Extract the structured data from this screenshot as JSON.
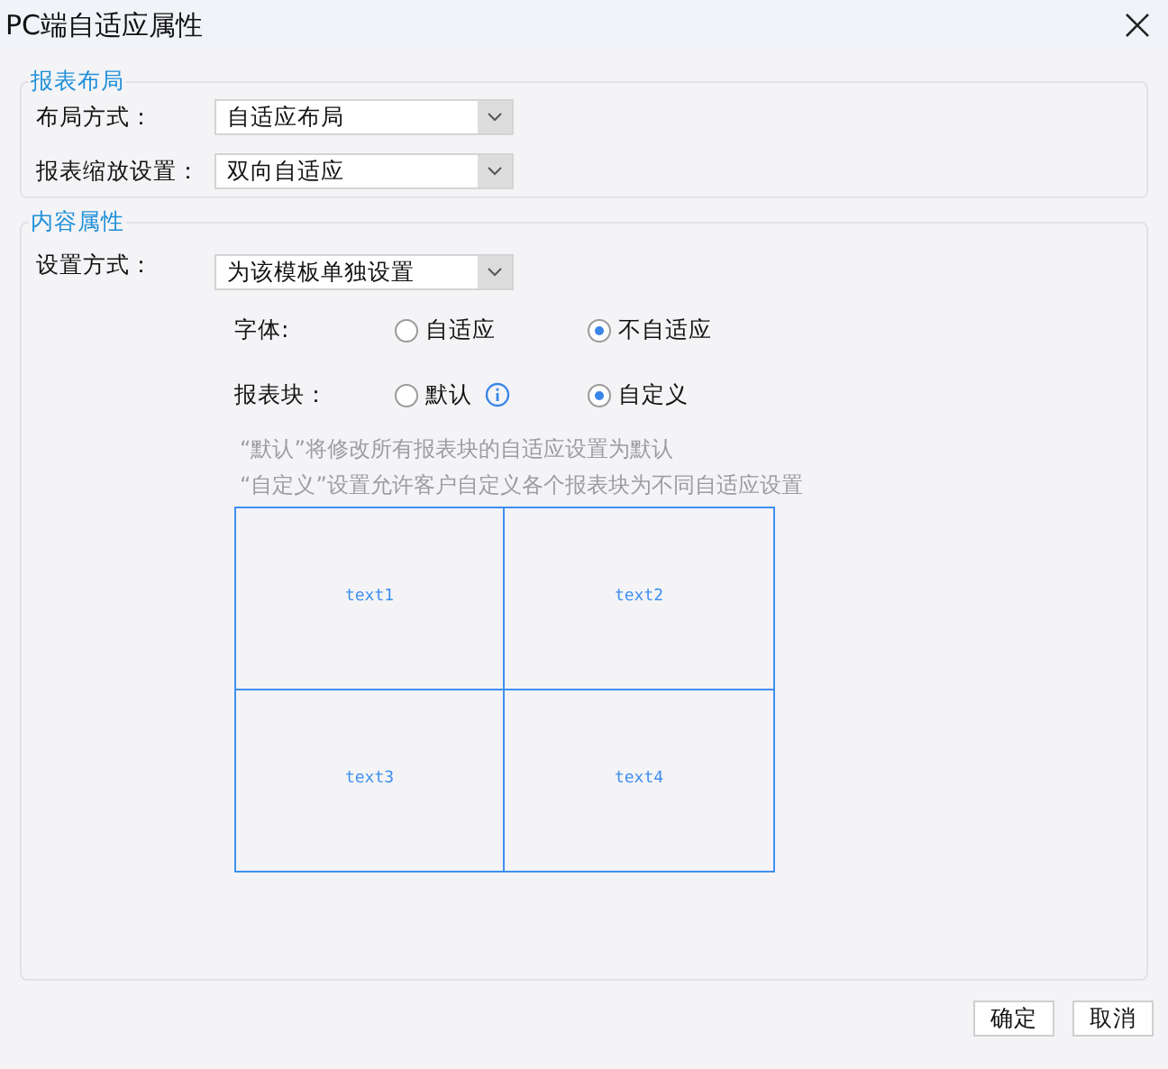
{
  "window": {
    "title": "PC端自适应属性"
  },
  "layout_section": {
    "title": "报表布局",
    "fields": [
      {
        "label": "布局方式：",
        "value": "自适应布局"
      },
      {
        "label": "报表缩放设置：",
        "value": "双向自适应"
      }
    ]
  },
  "content_section": {
    "title": "内容属性",
    "setting": {
      "label": "设置方式：",
      "value": "为该模板单独设置"
    },
    "radio_groups": [
      {
        "label": "字体:",
        "options": [
          {
            "label": "自适应",
            "selected": false,
            "info": false
          },
          {
            "label": "不自适应",
            "selected": true,
            "info": false
          }
        ]
      },
      {
        "label": "报表块：",
        "options": [
          {
            "label": "默认",
            "selected": false,
            "info": true
          },
          {
            "label": "自定义",
            "selected": true,
            "info": false
          }
        ]
      }
    ],
    "notes": [
      "“默认”将修改所有报表块的自适应设置为默认",
      "“自定义”设置允许客户自定义各个报表块为不同自适应设置"
    ],
    "blocks": [
      "text1",
      "text2",
      "text3",
      "text4"
    ]
  },
  "buttons": [
    "确定",
    "取消"
  ]
}
